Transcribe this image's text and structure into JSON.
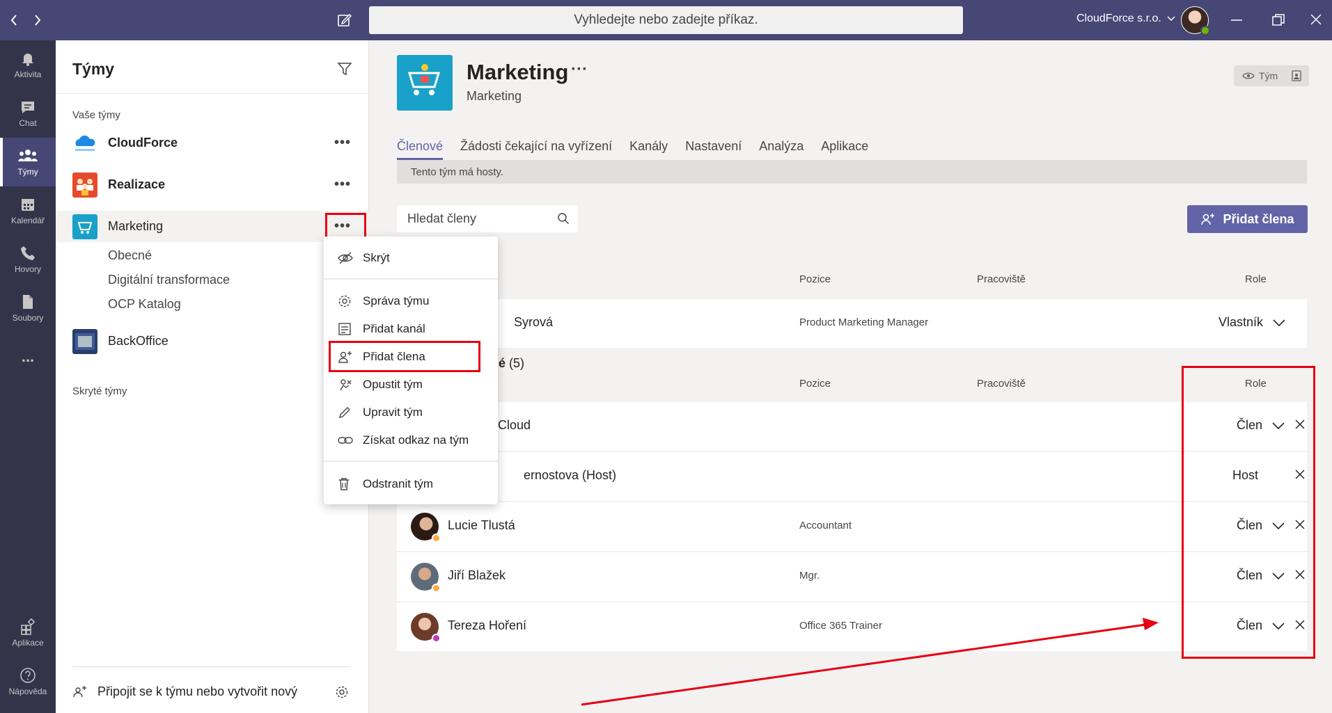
{
  "titlebar": {
    "search_placeholder": "Vyhledejte nebo zadejte příkaz.",
    "org_name": "CloudForce s.r.o."
  },
  "rail": {
    "items": [
      {
        "label": "Aktivita",
        "icon": "bell-icon"
      },
      {
        "label": "Chat",
        "icon": "chat-icon"
      },
      {
        "label": "Týmy",
        "icon": "teams-icon"
      },
      {
        "label": "Kalendář",
        "icon": "calendar-icon"
      },
      {
        "label": "Hovory",
        "icon": "phone-icon"
      },
      {
        "label": "Soubory",
        "icon": "file-icon"
      }
    ],
    "more": "...",
    "apps_label": "Aplikace",
    "help_label": "Nápověda"
  },
  "panel": {
    "title": "Týmy",
    "your_teams_label": "Vaše týmy",
    "teams": [
      {
        "name": "CloudForce"
      },
      {
        "name": "Realizace"
      },
      {
        "name": "Marketing"
      },
      {
        "name": "BackOffice"
      }
    ],
    "channels": [
      "Obecné",
      "Digitální transformace",
      "OCP Katalog"
    ],
    "hidden_teams_label": "Skryté týmy",
    "join_label": "Připojit se k týmu nebo vytvořit nový",
    "more_dots": "•••"
  },
  "context_menu": {
    "items": [
      {
        "label": "Skrýt",
        "icon": "eye-off-icon"
      },
      {
        "label": "Správa týmu",
        "icon": "gear-icon"
      },
      {
        "label": "Přidat kanál",
        "icon": "add-channel-icon"
      },
      {
        "label": "Přidat člena",
        "icon": "add-person-icon"
      },
      {
        "label": "Opustit tým",
        "icon": "leave-icon"
      },
      {
        "label": "Upravit tým",
        "icon": "pencil-icon"
      },
      {
        "label": "Získat odkaz na tým",
        "icon": "link-icon"
      },
      {
        "label": "Odstranit tým",
        "icon": "trash-icon"
      }
    ]
  },
  "main": {
    "team_title": "Marketing",
    "team_title_more": "···",
    "team_subtitle": "Marketing",
    "badge_label": "Tým",
    "tabs": [
      "Členové",
      "Žádosti čekající na vyřízení",
      "Kanály",
      "Nastavení",
      "Analýza",
      "Aplikace"
    ],
    "info_text": "Tento tým má hosty.",
    "member_search_placeholder": "Hledat členy",
    "add_member_label": "Přidat člena",
    "columns": {
      "position": "Pozice",
      "workplace": "Pracoviště",
      "role": "Role"
    },
    "owner": {
      "name_fragment": "Syrová",
      "position": "Product Marketing Manager",
      "role": "Vlastník"
    },
    "members_group_fragment": "é",
    "members_group_count": "(5)",
    "members": [
      {
        "name": "Cloud",
        "position": "",
        "role": "Člen",
        "removable": true,
        "role_dropdown": true
      },
      {
        "name": "ernostova (Host)",
        "position": "",
        "role": "Host",
        "removable": true,
        "role_dropdown": false
      },
      {
        "name": "Lucie Tlustá",
        "position": "Accountant",
        "role": "Člen",
        "removable": true,
        "role_dropdown": true
      },
      {
        "name": "Jiří Blažek",
        "position": "Mgr.",
        "role": "Člen",
        "removable": true,
        "role_dropdown": true
      },
      {
        "name": "Tereza Hoření",
        "position": "Office 365 Trainer",
        "role": "Člen",
        "removable": true,
        "role_dropdown": true
      }
    ]
  },
  "colors": {
    "titlebar": "#464775",
    "rail": "#33344a",
    "accent": "#6264a7",
    "annotation_red": "#e60012"
  }
}
